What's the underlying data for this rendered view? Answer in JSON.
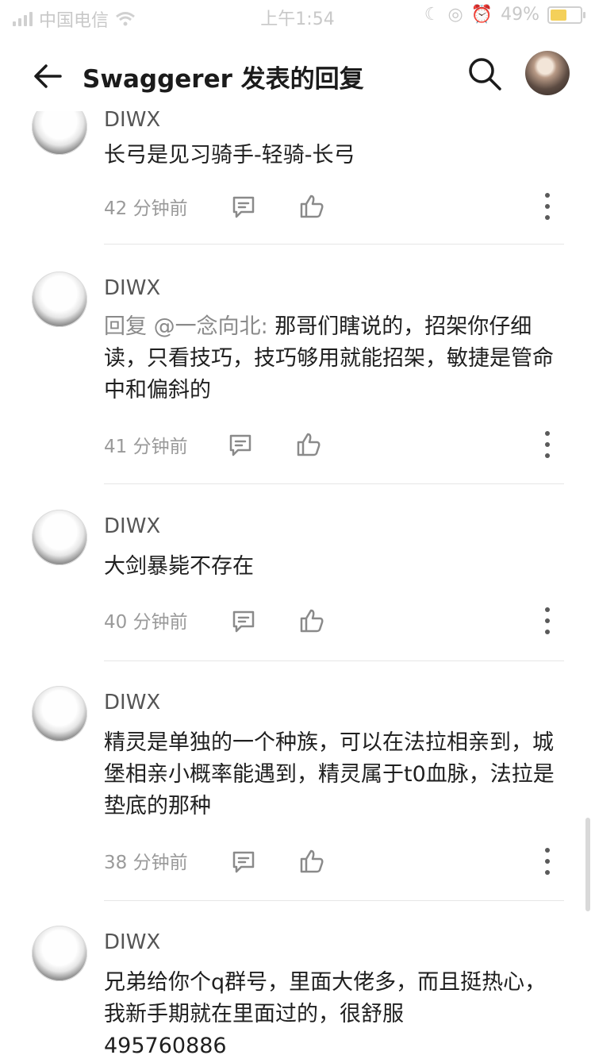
{
  "status": {
    "carrier": "中国电信",
    "time": "上午1:54",
    "battery": "49%"
  },
  "nav": {
    "title": "Swaggerer 发表的回复"
  },
  "comments": [
    {
      "author": "DIWX",
      "text": "长弓是见习骑手-轻骑-长弓",
      "time": "42 分钟前"
    },
    {
      "author": "DIWX",
      "mention": "回复 @一念向北: ",
      "text": "那哥们瞎说的，招架你仔细读，只看技巧，技巧够用就能招架，敏捷是管命中和偏斜的",
      "time": "41 分钟前"
    },
    {
      "author": "DIWX",
      "text": "大剑暴毙不存在",
      "time": "40 分钟前"
    },
    {
      "author": "DIWX",
      "text": "精灵是单独的一个种族，可以在法拉相亲到，城堡相亲小概率能遇到，精灵属于t0血脉，法拉是垫底的那种",
      "time": "38 分钟前"
    },
    {
      "author": "DIWX",
      "text": "兄弟给你个q群号，里面大佬多，而且挺热心，我新手期就在里面过的，很舒服\n495760886",
      "time": ""
    }
  ]
}
